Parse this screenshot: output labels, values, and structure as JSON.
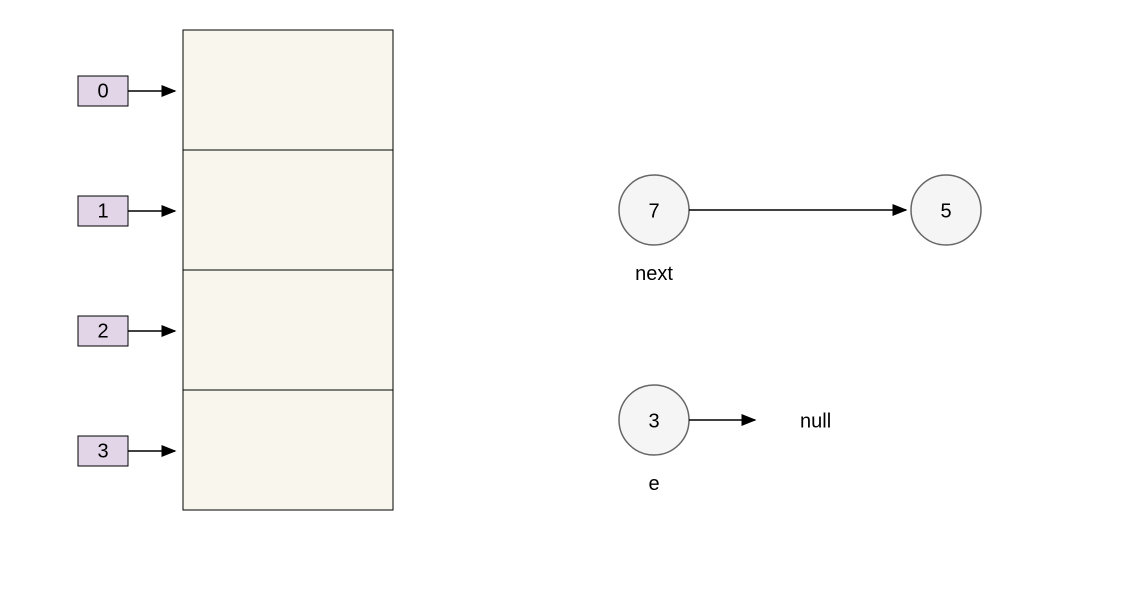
{
  "indices": [
    "0",
    "1",
    "2",
    "3"
  ],
  "nodes": {
    "top_left": "7",
    "top_right": "5",
    "bottom": "3"
  },
  "labels": {
    "next": "next",
    "e": "e",
    "null": "null"
  },
  "colors": {
    "index_fill": "#e1d5e7",
    "slot_fill": "#f9f7ed",
    "node_fill": "#f5f5f5",
    "node_stroke": "#666666"
  }
}
